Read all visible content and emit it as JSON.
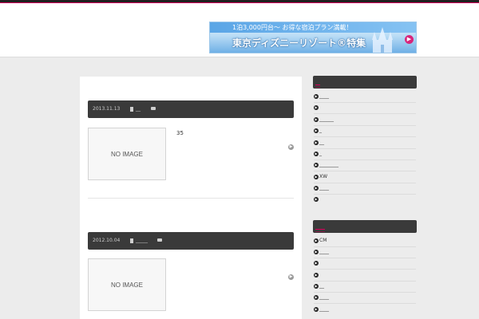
{
  "banner": {
    "top_text": "1泊3,000円台〜 お得な宿泊プラン満載！",
    "main_text": "東京ディズニーリゾート®特集",
    "arrow": "▶"
  },
  "posts": [
    {
      "date": "2013.11.13",
      "category": "__",
      "thumb_text": "NO IMAGE",
      "excerpt": "35",
      "more_icon": "▶"
    },
    {
      "date": "2012.10.04",
      "category": "_____",
      "thumb_text": "NO IMAGE",
      "excerpt": "",
      "more_icon": "▶"
    }
  ],
  "sidebar": {
    "widget1": {
      "title": "__",
      "items": [
        "____",
        "",
        "______",
        "_",
        "__",
        "_",
        "________",
        "XW",
        "____",
        ""
      ]
    },
    "widget2": {
      "title": "____",
      "items": [
        "CM",
        "____",
        "",
        "",
        "__",
        "____",
        "____"
      ]
    },
    "bullet": "▶"
  },
  "colors": {
    "accent": "#d8005a",
    "bar": "#3a3a3a",
    "page_bg": "#ececec"
  }
}
